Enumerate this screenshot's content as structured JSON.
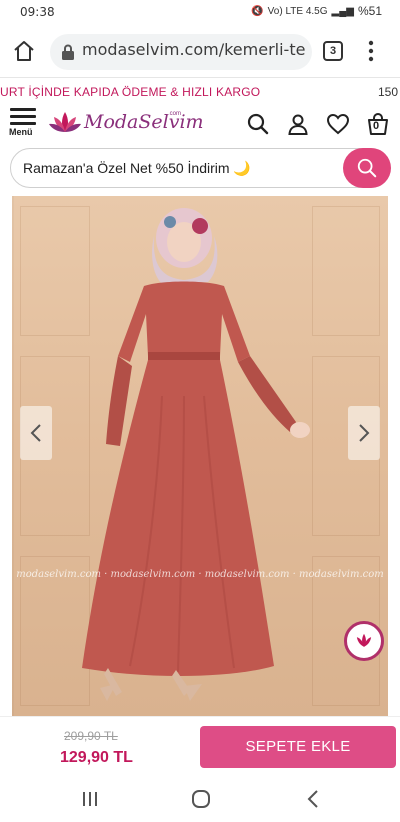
{
  "status_bar": {
    "time": "09:38",
    "network": "Vo) LTE 4.5G",
    "battery": "%51"
  },
  "browser": {
    "url": "modaselvim.com/kemerli-te",
    "tab_count": "3"
  },
  "promo": {
    "text": "URT İÇİNDE KAPIDA ÖDEME & HIZLI KARGO",
    "amount": "150"
  },
  "header": {
    "menu_label": "Menü",
    "logo_text": "ModaSelvim",
    "logo_domain": ".com",
    "cart_count": "0"
  },
  "search": {
    "placeholder": "Ramazan'a Özel Net %50 İndirim 🌙"
  },
  "gallery": {
    "watermark": "modaselvim.com · modaselvim.com · modaselvim.com · modaselvim.com"
  },
  "product": {
    "old_price": "209,90 TL",
    "price": "129,90 TL",
    "add_to_cart_label": "SEPETE EKLE"
  },
  "colors": {
    "brand_pink": "#de4d86",
    "price_pink": "#c2185b",
    "dress": "#c0584f"
  },
  "icons": [
    "home-icon",
    "lock-icon",
    "tabs-icon",
    "more-icon",
    "menu-icon",
    "search-icon",
    "user-icon",
    "heart-icon",
    "cart-icon",
    "chevron-left-icon",
    "chevron-right-icon",
    "nav-recents-icon",
    "nav-home-icon",
    "nav-back-icon"
  ]
}
